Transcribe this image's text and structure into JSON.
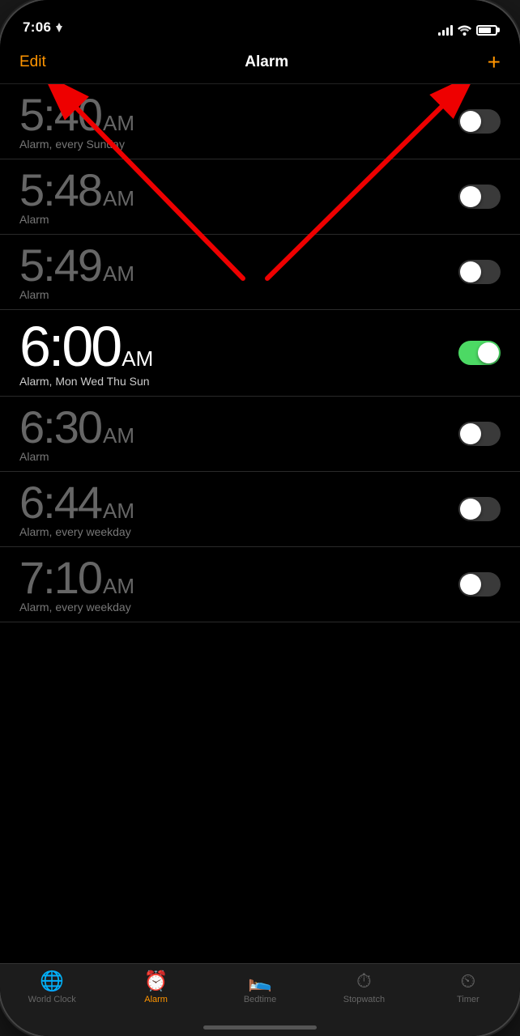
{
  "statusBar": {
    "time": "7:06",
    "locationArrow": true
  },
  "navBar": {
    "editLabel": "Edit",
    "title": "Alarm",
    "addLabel": "+"
  },
  "alarms": [
    {
      "id": 1,
      "hour": "5",
      "colon": ":",
      "minute": "40",
      "ampm": "AM",
      "label": "Alarm, every Sunday",
      "active": false,
      "toggleOn": false
    },
    {
      "id": 2,
      "hour": "5",
      "colon": ":",
      "minute": "48",
      "ampm": "AM",
      "label": "Alarm",
      "active": false,
      "toggleOn": false
    },
    {
      "id": 3,
      "hour": "5",
      "colon": ":",
      "minute": "49",
      "ampm": "AM",
      "label": "Alarm",
      "active": false,
      "toggleOn": false
    },
    {
      "id": 4,
      "hour": "6",
      "colon": ":",
      "minute": "00",
      "ampm": "AM",
      "label": "Alarm, Mon Wed Thu Sun",
      "active": true,
      "toggleOn": true
    },
    {
      "id": 5,
      "hour": "6",
      "colon": ":",
      "minute": "30",
      "ampm": "AM",
      "label": "Alarm",
      "active": false,
      "toggleOn": false
    },
    {
      "id": 6,
      "hour": "6",
      "colon": ":",
      "minute": "44",
      "ampm": "AM",
      "label": "Alarm, every weekday",
      "active": false,
      "toggleOn": false
    },
    {
      "id": 7,
      "hour": "7",
      "colon": ":",
      "minute": "10",
      "ampm": "AM",
      "label": "Alarm, every weekday",
      "active": false,
      "toggleOn": false
    }
  ],
  "tabBar": {
    "items": [
      {
        "id": "world-clock",
        "label": "World Clock",
        "icon": "🌐",
        "active": false
      },
      {
        "id": "alarm",
        "label": "Alarm",
        "icon": "⏰",
        "active": true
      },
      {
        "id": "bedtime",
        "label": "Bedtime",
        "icon": "🛌",
        "active": false
      },
      {
        "id": "stopwatch",
        "label": "Stopwatch",
        "icon": "⏱",
        "active": false
      },
      {
        "id": "timer",
        "label": "Timer",
        "icon": "⏲",
        "active": false
      }
    ]
  }
}
